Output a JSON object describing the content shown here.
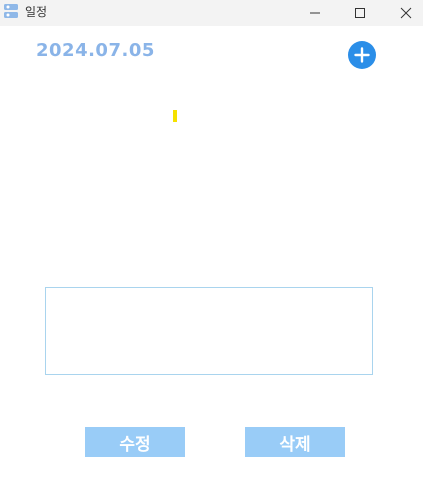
{
  "window": {
    "title": "일정",
    "app_icon": "calendar-app-icon",
    "controls": {
      "minimize_icon": "minimize-icon",
      "maximize_icon": "maximize-icon",
      "close_icon": "close-icon"
    }
  },
  "header": {
    "date": "2024.07.05",
    "add_icon": "plus-circle-icon"
  },
  "buttons": {
    "edit_label": "수정",
    "delete_label": "삭제"
  },
  "colors": {
    "accent": "#2b8ee8",
    "date_text": "#8ab4e8",
    "button_bg": "#99ccf7",
    "input_border": "#a9d4ee",
    "caret": "#f5e100"
  }
}
